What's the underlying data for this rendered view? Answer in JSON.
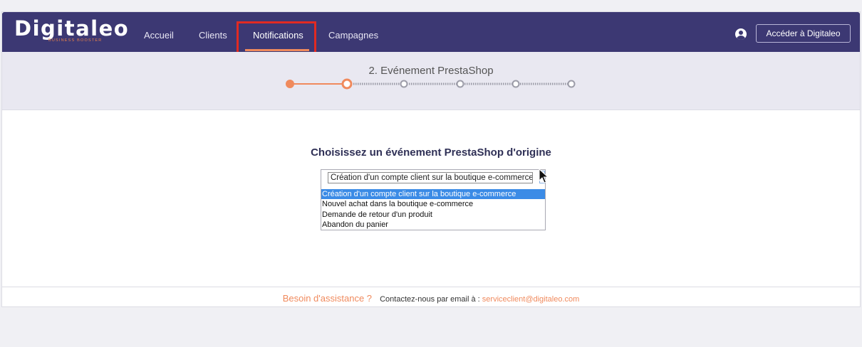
{
  "brand": {
    "logo_text": "Digitaleo",
    "logo_tagline": "BUSINESS BOOSTER"
  },
  "nav": {
    "items": [
      "Accueil",
      "Clients",
      "Notifications",
      "Campagnes"
    ],
    "active": "Notifications"
  },
  "header": {
    "user_icon": "user-circle-icon",
    "cta_label": "Accéder à Digitaleo"
  },
  "stepper": {
    "title": "2. Evénement PrestaShop",
    "total_steps": 6,
    "current_step": 2,
    "accent_color": "#f08a5d",
    "inactive_color": "#9c9ca8"
  },
  "main": {
    "title": "Choisissez un événement PrestaShop d'origine",
    "select": {
      "current_value": "Création d'un compte client sur la boutique e-commerce",
      "options": [
        "Création d'un compte client sur la boutique e-commerce",
        "Nouvel achat dans la boutique e-commerce",
        "Demande de retour d'un produit",
        "Abandon du panier"
      ],
      "highlighted_index": 0
    }
  },
  "footer": {
    "help_text": "Besoin d'assistance ?",
    "contact_text": "Contactez-nous par email à :",
    "email": "serviceclient@digitaleo.com"
  },
  "colors": {
    "navbar_bg": "#3c3873",
    "accent": "#f08a5d",
    "highlight_box": "#e12a22",
    "option_selected": "#3b8be6"
  }
}
